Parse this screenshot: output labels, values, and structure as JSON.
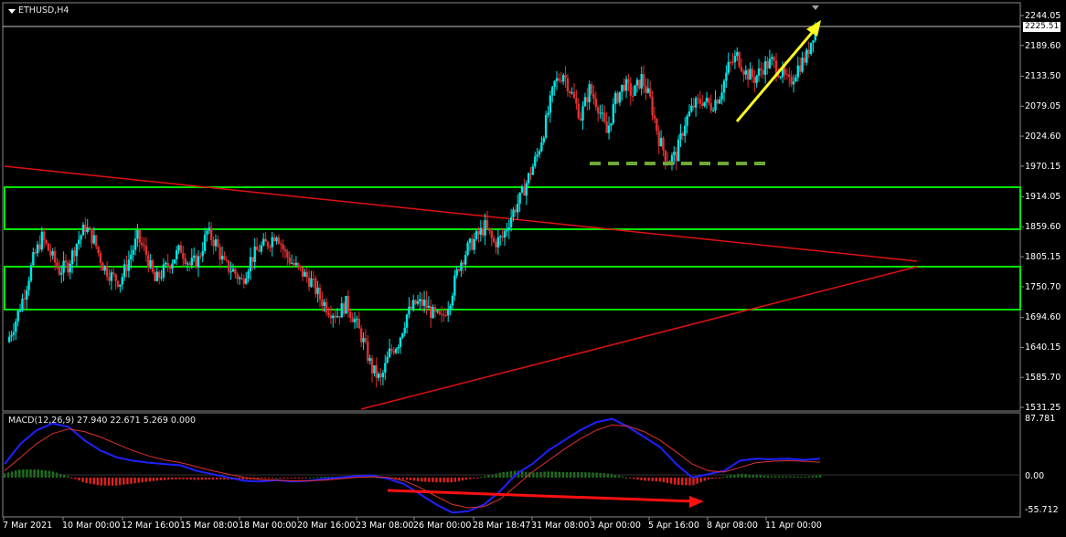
{
  "header": {
    "symbol_tf": "ETHUSD,H4"
  },
  "macd_panel": {
    "title": "MACD(12,26,9) 27.940 22.671 5.269 0.000"
  },
  "price_axis": {
    "labels": [
      "2244.05",
      "2189.60",
      "2133.50",
      "2079.05",
      "2024.60",
      "1970.15",
      "1914.05",
      "1859.60",
      "1805.15",
      "1750.70",
      "1694.60",
      "1640.15",
      "1585.70",
      "1531.25"
    ],
    "current_price": "2225.51"
  },
  "macd_axis": {
    "labels": [
      "87.781",
      "0.00",
      "-55.712"
    ]
  },
  "time_axis": {
    "labels": [
      "7 Mar 2021",
      "10 Mar 00:00",
      "12 Mar 16:00",
      "15 Mar 08:00",
      "18 Mar 00:00",
      "20 Mar 16:00",
      "23 Mar 08:00",
      "26 Mar 00:00",
      "28 Mar 18:47",
      "31 Mar 08:00",
      "3 Apr 00:00",
      "5 Apr 16:00",
      "8 Apr 08:00",
      "11 Apr 00:00"
    ]
  },
  "colors": {
    "background": "#000000",
    "bull_candle": "#00e5e5",
    "bear_candle": "#e03030",
    "zone_box": "#00e600",
    "trendline": "#e01010",
    "arrow_up": "#ffff20",
    "support_dash": "#6fa836",
    "macd_line": "#2020ff",
    "signal_line": "#e03030",
    "hist_pos": "#1a7a1a",
    "hist_neg": "#e02020",
    "divergence_arrow": "#ff1010"
  },
  "chart_data": [
    {
      "type": "candlestick",
      "symbol": "ETHUSD",
      "timeframe": "H4",
      "ylim": [
        1531.25,
        2244.05
      ],
      "x": [
        "7 Mar 2021",
        "10 Mar 00:00",
        "12 Mar 16:00",
        "15 Mar 08:00",
        "18 Mar 00:00",
        "20 Mar 16:00",
        "23 Mar 08:00",
        "26 Mar 00:00",
        "28 Mar 18:47",
        "31 Mar 08:00",
        "3 Apr 00:00",
        "5 Apr 16:00",
        "8 Apr 08:00",
        "11 Apr 00:00"
      ],
      "close_path": [
        1650,
        1690,
        1740,
        1800,
        1840,
        1810,
        1780,
        1790,
        1830,
        1860,
        1835,
        1790,
        1770,
        1760,
        1800,
        1840,
        1810,
        1760,
        1780,
        1800,
        1820,
        1790,
        1800,
        1850,
        1830,
        1790,
        1780,
        1760,
        1800,
        1820,
        1830,
        1850,
        1810,
        1790,
        1775,
        1760,
        1730,
        1710,
        1700,
        1720,
        1690,
        1650,
        1600,
        1580,
        1630,
        1650,
        1700,
        1720,
        1720,
        1700,
        1690,
        1730,
        1790,
        1820,
        1840,
        1860,
        1830,
        1840,
        1880,
        1910,
        1950,
        1990,
        2050,
        2120,
        2140,
        2100,
        2060,
        2110,
        2080,
        2030,
        2090,
        2120,
        2100,
        2130,
        2090,
        2020,
        1980,
        1990,
        2050,
        2080,
        2090,
        2080,
        2100,
        2150,
        2170,
        2140,
        2130,
        2150,
        2160,
        2140,
        2120,
        2150,
        2170,
        2225.51
      ],
      "zones": [
        [
          1859.6,
          1914.05
        ],
        [
          1710,
          1782
        ]
      ],
      "support_level": 1975,
      "current_price": 2225.51
    },
    {
      "type": "macd",
      "params": "12,26,9",
      "macd": 27.94,
      "signal": 22.671,
      "histogram": 5.269,
      "ylim": [
        -55.712,
        87.781
      ],
      "macd_path": [
        20,
        50,
        70,
        80,
        75,
        55,
        40,
        30,
        25,
        22,
        20,
        18,
        10,
        5,
        0,
        -5,
        -6,
        -4,
        -6,
        -5,
        -2,
        0,
        2,
        3,
        -2,
        -10,
        -25,
        -40,
        -52,
        -50,
        -40,
        -20,
        5,
        20,
        40,
        55,
        70,
        82,
        87,
        75,
        60,
        45,
        20,
        0,
        5,
        10,
        25,
        28,
        27,
        28,
        26,
        27.94
      ],
      "signal_path": [
        10,
        30,
        50,
        65,
        72,
        68,
        60,
        50,
        40,
        32,
        26,
        22,
        16,
        10,
        5,
        0,
        -3,
        -4,
        -5,
        -5,
        -4,
        -2,
        0,
        1,
        0,
        -5,
        -15,
        -28,
        -40,
        -45,
        -43,
        -32,
        -12,
        8,
        25,
        42,
        57,
        70,
        78,
        76,
        68,
        55,
        38,
        20,
        10,
        8,
        15,
        22,
        24,
        25,
        24,
        22.671
      ]
    }
  ]
}
